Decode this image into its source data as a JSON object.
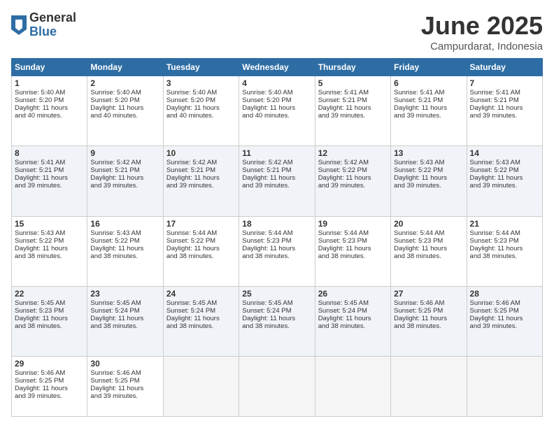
{
  "logo": {
    "general": "General",
    "blue": "Blue"
  },
  "title": "June 2025",
  "location": "Campurdarat, Indonesia",
  "headers": [
    "Sunday",
    "Monday",
    "Tuesday",
    "Wednesday",
    "Thursday",
    "Friday",
    "Saturday"
  ],
  "rows": [
    [
      {
        "day": "1",
        "lines": [
          "Sunrise: 5:40 AM",
          "Sunset: 5:20 PM",
          "Daylight: 11 hours",
          "and 40 minutes."
        ]
      },
      {
        "day": "2",
        "lines": [
          "Sunrise: 5:40 AM",
          "Sunset: 5:20 PM",
          "Daylight: 11 hours",
          "and 40 minutes."
        ]
      },
      {
        "day": "3",
        "lines": [
          "Sunrise: 5:40 AM",
          "Sunset: 5:20 PM",
          "Daylight: 11 hours",
          "and 40 minutes."
        ]
      },
      {
        "day": "4",
        "lines": [
          "Sunrise: 5:40 AM",
          "Sunset: 5:20 PM",
          "Daylight: 11 hours",
          "and 40 minutes."
        ]
      },
      {
        "day": "5",
        "lines": [
          "Sunrise: 5:41 AM",
          "Sunset: 5:21 PM",
          "Daylight: 11 hours",
          "and 39 minutes."
        ]
      },
      {
        "day": "6",
        "lines": [
          "Sunrise: 5:41 AM",
          "Sunset: 5:21 PM",
          "Daylight: 11 hours",
          "and 39 minutes."
        ]
      },
      {
        "day": "7",
        "lines": [
          "Sunrise: 5:41 AM",
          "Sunset: 5:21 PM",
          "Daylight: 11 hours",
          "and 39 minutes."
        ]
      }
    ],
    [
      {
        "day": "8",
        "lines": [
          "Sunrise: 5:41 AM",
          "Sunset: 5:21 PM",
          "Daylight: 11 hours",
          "and 39 minutes."
        ]
      },
      {
        "day": "9",
        "lines": [
          "Sunrise: 5:42 AM",
          "Sunset: 5:21 PM",
          "Daylight: 11 hours",
          "and 39 minutes."
        ]
      },
      {
        "day": "10",
        "lines": [
          "Sunrise: 5:42 AM",
          "Sunset: 5:21 PM",
          "Daylight: 11 hours",
          "and 39 minutes."
        ]
      },
      {
        "day": "11",
        "lines": [
          "Sunrise: 5:42 AM",
          "Sunset: 5:21 PM",
          "Daylight: 11 hours",
          "and 39 minutes."
        ]
      },
      {
        "day": "12",
        "lines": [
          "Sunrise: 5:42 AM",
          "Sunset: 5:22 PM",
          "Daylight: 11 hours",
          "and 39 minutes."
        ]
      },
      {
        "day": "13",
        "lines": [
          "Sunrise: 5:43 AM",
          "Sunset: 5:22 PM",
          "Daylight: 11 hours",
          "and 39 minutes."
        ]
      },
      {
        "day": "14",
        "lines": [
          "Sunrise: 5:43 AM",
          "Sunset: 5:22 PM",
          "Daylight: 11 hours",
          "and 39 minutes."
        ]
      }
    ],
    [
      {
        "day": "15",
        "lines": [
          "Sunrise: 5:43 AM",
          "Sunset: 5:22 PM",
          "Daylight: 11 hours",
          "and 38 minutes."
        ]
      },
      {
        "day": "16",
        "lines": [
          "Sunrise: 5:43 AM",
          "Sunset: 5:22 PM",
          "Daylight: 11 hours",
          "and 38 minutes."
        ]
      },
      {
        "day": "17",
        "lines": [
          "Sunrise: 5:44 AM",
          "Sunset: 5:22 PM",
          "Daylight: 11 hours",
          "and 38 minutes."
        ]
      },
      {
        "day": "18",
        "lines": [
          "Sunrise: 5:44 AM",
          "Sunset: 5:23 PM",
          "Daylight: 11 hours",
          "and 38 minutes."
        ]
      },
      {
        "day": "19",
        "lines": [
          "Sunrise: 5:44 AM",
          "Sunset: 5:23 PM",
          "Daylight: 11 hours",
          "and 38 minutes."
        ]
      },
      {
        "day": "20",
        "lines": [
          "Sunrise: 5:44 AM",
          "Sunset: 5:23 PM",
          "Daylight: 11 hours",
          "and 38 minutes."
        ]
      },
      {
        "day": "21",
        "lines": [
          "Sunrise: 5:44 AM",
          "Sunset: 5:23 PM",
          "Daylight: 11 hours",
          "and 38 minutes."
        ]
      }
    ],
    [
      {
        "day": "22",
        "lines": [
          "Sunrise: 5:45 AM",
          "Sunset: 5:23 PM",
          "Daylight: 11 hours",
          "and 38 minutes."
        ]
      },
      {
        "day": "23",
        "lines": [
          "Sunrise: 5:45 AM",
          "Sunset: 5:24 PM",
          "Daylight: 11 hours",
          "and 38 minutes."
        ]
      },
      {
        "day": "24",
        "lines": [
          "Sunrise: 5:45 AM",
          "Sunset: 5:24 PM",
          "Daylight: 11 hours",
          "and 38 minutes."
        ]
      },
      {
        "day": "25",
        "lines": [
          "Sunrise: 5:45 AM",
          "Sunset: 5:24 PM",
          "Daylight: 11 hours",
          "and 38 minutes."
        ]
      },
      {
        "day": "26",
        "lines": [
          "Sunrise: 5:45 AM",
          "Sunset: 5:24 PM",
          "Daylight: 11 hours",
          "and 38 minutes."
        ]
      },
      {
        "day": "27",
        "lines": [
          "Sunrise: 5:46 AM",
          "Sunset: 5:25 PM",
          "Daylight: 11 hours",
          "and 38 minutes."
        ]
      },
      {
        "day": "28",
        "lines": [
          "Sunrise: 5:46 AM",
          "Sunset: 5:25 PM",
          "Daylight: 11 hours",
          "and 39 minutes."
        ]
      }
    ],
    [
      {
        "day": "29",
        "lines": [
          "Sunrise: 5:46 AM",
          "Sunset: 5:25 PM",
          "Daylight: 11 hours",
          "and 39 minutes."
        ]
      },
      {
        "day": "30",
        "lines": [
          "Sunrise: 5:46 AM",
          "Sunset: 5:25 PM",
          "Daylight: 11 hours",
          "and 39 minutes."
        ]
      },
      {
        "day": "",
        "lines": []
      },
      {
        "day": "",
        "lines": []
      },
      {
        "day": "",
        "lines": []
      },
      {
        "day": "",
        "lines": []
      },
      {
        "day": "",
        "lines": []
      }
    ]
  ]
}
